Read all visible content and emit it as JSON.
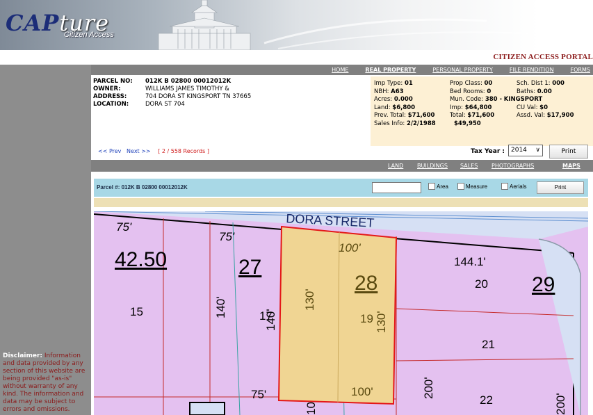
{
  "header": {
    "logo_main": "CAP",
    "logo_script": "ture",
    "logo_sub": "Citizen Access",
    "portal_title": "CITIZEN ACCESS PORTAL"
  },
  "top_nav": [
    {
      "label": "HOME",
      "active": false
    },
    {
      "label": "REAL PROPERTY",
      "active": true
    },
    {
      "label": "PERSONAL PROPERTY",
      "active": false
    },
    {
      "label": "FILE RENDITION",
      "active": false
    },
    {
      "label": "FORMS",
      "active": false
    }
  ],
  "parcel": {
    "parcel_no_label": "PARCEL NO:",
    "parcel_no": "012K B 02800 00012012K",
    "owner_label": "OWNER:",
    "owner": "WILLIAMS JAMES TIMOTHY &",
    "address_label": "ADDRESS:",
    "address": "704 DORA ST KINGSPORT TN 37665",
    "location_label": "LOCATION:",
    "location": "DORA ST 704"
  },
  "stats": {
    "imp_type_label": "Imp Type:",
    "imp_type": "01",
    "prop_class_label": "Prop Class:",
    "prop_class": "00",
    "sch_dist_label": "Sch. Dist 1:",
    "sch_dist": "000",
    "nbh_label": "NBH:",
    "nbh": "A63",
    "bed_rooms_label": "Bed Rooms:",
    "bed_rooms": "0",
    "baths_label": "Baths:",
    "baths": "0.00",
    "acres_label": "Acres:",
    "acres": "0.000",
    "mun_code_label": "Mun. Code:",
    "mun_code": "380 -",
    "mun_name": "KINGSPORT",
    "land_label": "Land:",
    "land": "$6,800",
    "imp_label": "Imp:",
    "imp": "$64,800",
    "cu_val_label": "CU Val:",
    "cu_val": "$0",
    "prev_total_label": "Prev. Total:",
    "prev_total": "$71,600",
    "total_label": "Total:",
    "total": "$71,600",
    "assd_val_label": "Assd. Val:",
    "assd_val": "$17,900",
    "sales_info_label": "Sales Info:",
    "sales_date": "2/2/1988",
    "sales_price": "$49,950"
  },
  "record_nav": {
    "prev": "<< Prev",
    "next": "Next >>",
    "count": "[ 2 / 558 Records ]"
  },
  "tax_year": {
    "label": "Tax Year :",
    "selected": "2014 ",
    "print_label": "Print"
  },
  "sub_nav": [
    {
      "label": "LAND",
      "active": false
    },
    {
      "label": "BUILDINGS",
      "active": false
    },
    {
      "label": "SALES",
      "active": false
    },
    {
      "label": "PHOTOGRAPHS",
      "active": false
    },
    {
      "label": "MAPS",
      "active": true
    }
  ],
  "map_bar": {
    "parcel_label": "Parcel #: 012K B 02800 00012012K",
    "search_value": "",
    "area_label": "Area",
    "measure_label": "Measure",
    "aerials_label": "Aerials",
    "print_label": "Print"
  },
  "map": {
    "street_name": "DORA STREET",
    "lot_numbers": [
      "42.50",
      "27",
      "28",
      "29",
      "15",
      "17",
      "19",
      "20",
      "21",
      "22"
    ],
    "dimensions": [
      "75'",
      "75'",
      "100'",
      "144.1'",
      "140'",
      "130'",
      "140'",
      "130'",
      "75'",
      "100'",
      "200'",
      "200'",
      "10"
    ],
    "colors": {
      "parcel_fill": "#e4c1f0",
      "selected_fill": "#f0d593",
      "selected_border": "#e41818",
      "street_fill": "#d6e0f4"
    }
  },
  "disclaimer": {
    "title": "Disclaimer:",
    "text": "Information and data provided by any section of this website are being provided \"as-is\" without warranty of any kind. The information and data may be subject to errors and omissions."
  }
}
